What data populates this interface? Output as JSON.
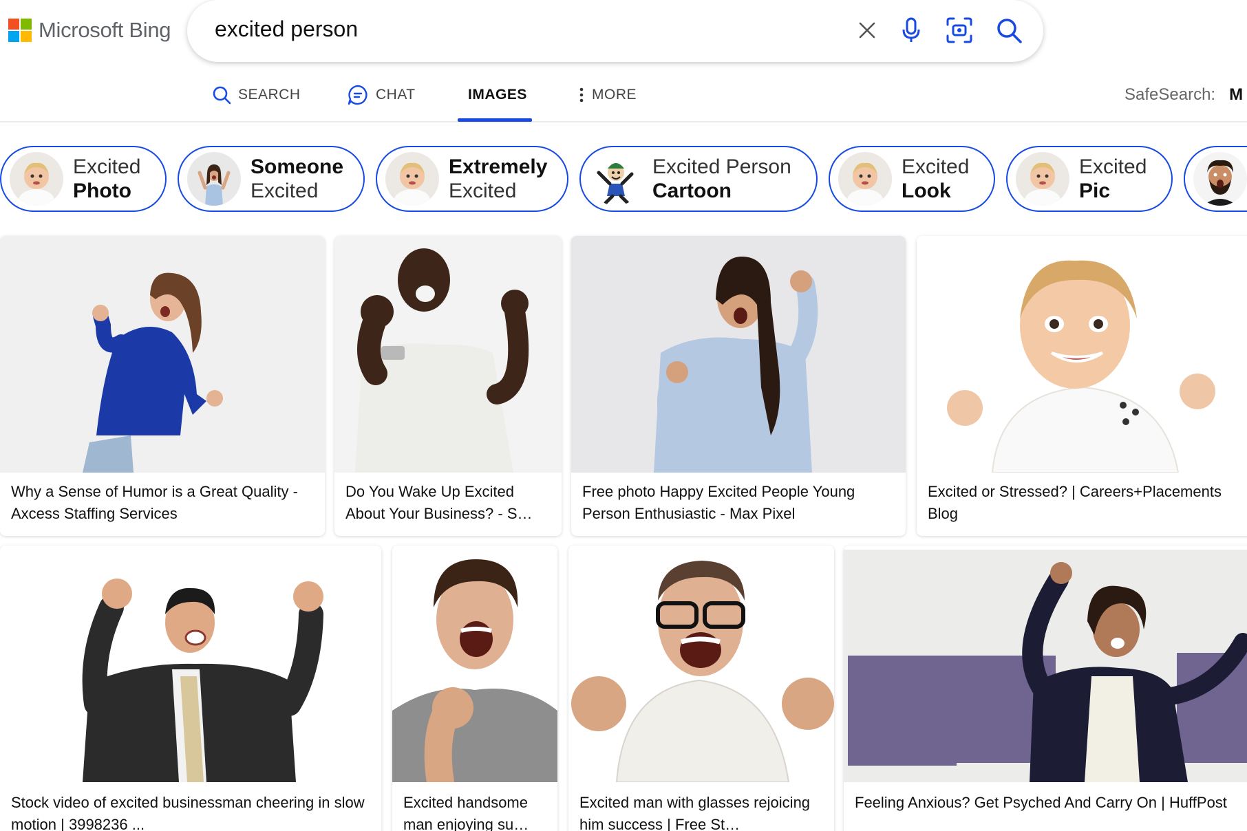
{
  "brand": {
    "name": "Microsoft Bing",
    "colors": [
      "#f25022",
      "#7fba00",
      "#00a4ef",
      "#ffb900"
    ]
  },
  "search": {
    "query": "excited person",
    "accent": "#174ae4"
  },
  "icons": {
    "clear": "close-icon",
    "mic": "microphone-icon",
    "visual": "visual-search-icon",
    "search": "search-icon"
  },
  "nav": {
    "items": [
      {
        "label": "SEARCH",
        "icon": "search-icon"
      },
      {
        "label": "CHAT",
        "icon": "chat-icon"
      },
      {
        "label": "IMAGES",
        "active": true
      },
      {
        "label": "MORE",
        "icon": "more-vertical-icon"
      }
    ],
    "safesearch_label": "SafeSearch:",
    "safesearch_value": "M"
  },
  "related": [
    {
      "line1": "Excited",
      "line2": "Photo"
    },
    {
      "line1": "Someone",
      "line2": "Excited"
    },
    {
      "line1": "Extremely",
      "line2": "Excited"
    },
    {
      "line1": "Excited Person",
      "line2": "Cartoon"
    },
    {
      "line1": "Excited",
      "line2": "Look"
    },
    {
      "line1": "Excited",
      "line2": "Pic"
    }
  ],
  "results": [
    {
      "caption": "Why a Sense of Humor is a Great Quality - Axcess Staffing Services"
    },
    {
      "caption": "Do You Wake Up Excited About Your Business? - S…"
    },
    {
      "caption": "Free photo Happy Excited People Young Person Enthusiastic - Max Pixel"
    },
    {
      "caption": "Excited or Stressed? | Careers+Placements Blog"
    },
    {
      "caption": "Stock video of excited businessman cheering in slow motion | 3998236 ..."
    },
    {
      "caption": "Excited handsome man enjoying su…"
    },
    {
      "caption": "Excited man with glasses rejoicing him success | Free St…"
    },
    {
      "caption": "Feeling Anxious? Get Psyched And Carry On | HuffPost"
    }
  ]
}
